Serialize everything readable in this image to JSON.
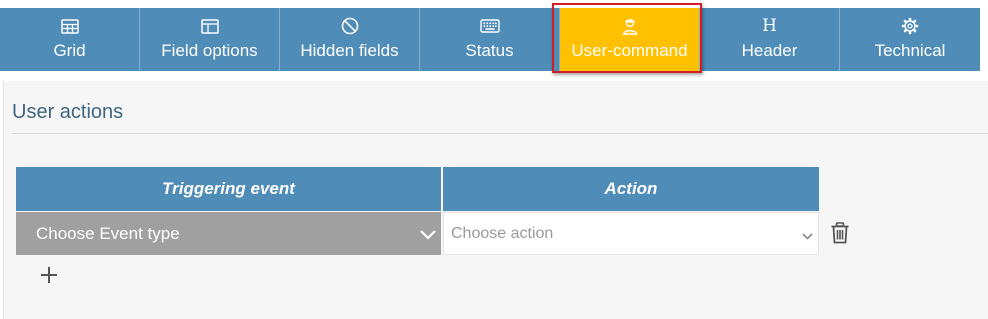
{
  "tabs": [
    {
      "label": "Grid",
      "icon": "grid-icon"
    },
    {
      "label": "Field options",
      "icon": "columns-icon"
    },
    {
      "label": "Hidden fields",
      "icon": "block-icon"
    },
    {
      "label": "Status",
      "icon": "keyboard-icon"
    },
    {
      "label": "User-command",
      "icon": "user-icon"
    },
    {
      "label": "Header",
      "icon": "header-icon",
      "glyph": "H"
    },
    {
      "label": "Technical",
      "icon": "gear-icon"
    }
  ],
  "active_tab": "User-command",
  "section": {
    "title": "User actions"
  },
  "table": {
    "headers": [
      "Triggering event",
      "Action"
    ],
    "rows": [
      {
        "event_value": "Choose Event type",
        "action_placeholder": "Choose action"
      }
    ]
  },
  "colors": {
    "tab_bg": "#4f8cb8",
    "active_tab": "#ffc000",
    "highlight": "#d21f26",
    "select_bg": "#a0a0a0"
  }
}
